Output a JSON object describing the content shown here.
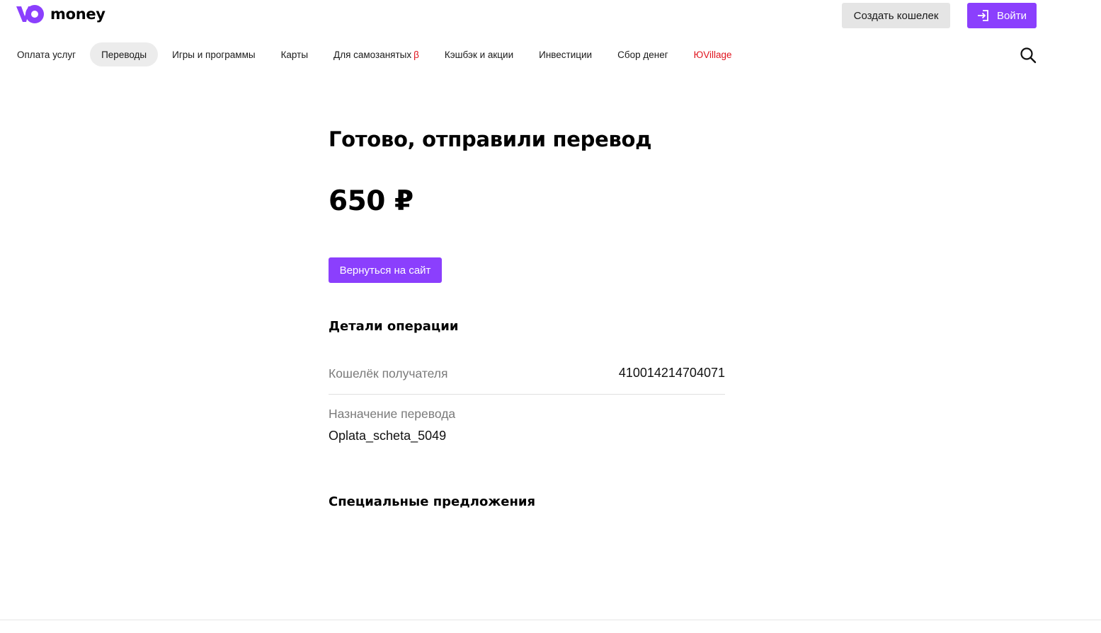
{
  "header": {
    "logo_text": "money",
    "create_wallet_label": "Создать кошелек",
    "login_label": "Войти",
    "brand_color": "#8b3ffd"
  },
  "nav": {
    "items": [
      {
        "label": "Оплата услуг",
        "active": false
      },
      {
        "label": "Переводы",
        "active": true
      },
      {
        "label": "Игры и программы",
        "active": false
      },
      {
        "label": "Карты",
        "active": false
      },
      {
        "label": "Для самозанятых",
        "badge": "β",
        "active": false
      },
      {
        "label": "Кэшбэк и акции",
        "active": false
      },
      {
        "label": "Инвестиции",
        "active": false
      },
      {
        "label": "Сбор денег",
        "active": false
      },
      {
        "label": "ЮVillage",
        "active": false,
        "color": "#e0141e"
      }
    ],
    "search_icon": "search-icon"
  },
  "main": {
    "title": "Готово, отправили перевод",
    "amount": "650 ₽",
    "back_button_label": "Вернуться на сайт",
    "details_title": "Детали операции",
    "details": {
      "wallet_label": "Кошелёк получателя",
      "wallet_value": "410014214704071",
      "purpose_label": "Назначение перевода",
      "purpose_value": "Oplata_scheta_5049"
    },
    "offers_title": "Специальные предложения"
  }
}
